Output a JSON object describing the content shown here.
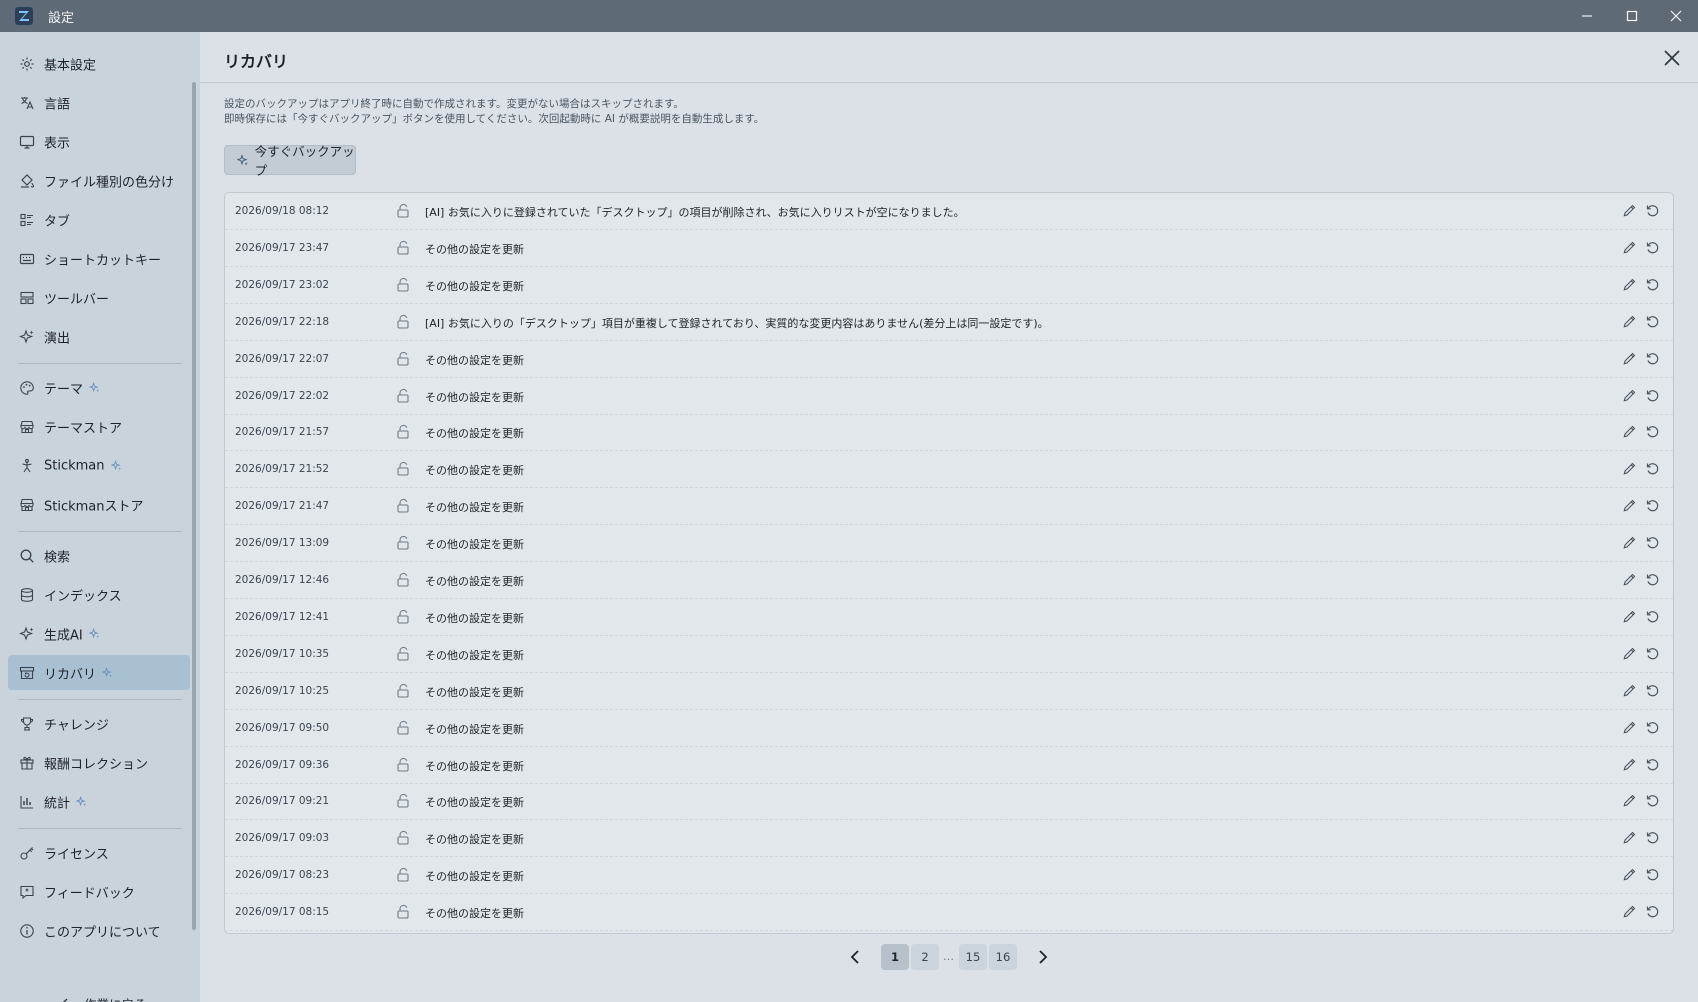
{
  "window": {
    "title": "設定"
  },
  "sidebar": {
    "groups": [
      [
        {
          "label": "基本設定",
          "icon": "gear-icon"
        },
        {
          "label": "言語",
          "icon": "translate-icon"
        },
        {
          "label": "表示",
          "icon": "monitor-icon"
        },
        {
          "label": "ファイル種別の色分け",
          "icon": "paint-bucket-icon"
        },
        {
          "label": "タブ",
          "icon": "tabs-list-icon"
        },
        {
          "label": "ショートカットキー",
          "icon": "keyboard-icon"
        },
        {
          "label": "ツールバー",
          "icon": "toolbar-grid-icon"
        },
        {
          "label": "演出",
          "icon": "sparkle-icon"
        }
      ],
      [
        {
          "label": "テーマ",
          "icon": "palette-icon",
          "ai": true
        },
        {
          "label": "テーマストア",
          "icon": "store-icon"
        },
        {
          "label": "Stickman",
          "icon": "stickman-icon",
          "ai": true
        },
        {
          "label": "Stickmanストア",
          "icon": "store-icon"
        }
      ],
      [
        {
          "label": "検索",
          "icon": "search-icon"
        },
        {
          "label": "インデックス",
          "icon": "database-icon"
        },
        {
          "label": "生成AI",
          "icon": "sparkle-icon",
          "ai": true
        },
        {
          "label": "リカバリ",
          "icon": "recovery-box-icon",
          "ai": true,
          "active": true
        }
      ],
      [
        {
          "label": "チャレンジ",
          "icon": "trophy-icon"
        },
        {
          "label": "報酬コレクション",
          "icon": "gift-icon"
        },
        {
          "label": "統計",
          "icon": "bar-chart-icon",
          "ai": true
        }
      ],
      [
        {
          "label": "ライセンス",
          "icon": "key-icon"
        },
        {
          "label": "フィードバック",
          "icon": "feedback-icon"
        },
        {
          "label": "このアプリについて",
          "icon": "info-icon"
        }
      ]
    ],
    "back_label": "作業に戻る"
  },
  "main": {
    "title": "リカバリ",
    "description": [
      "設定のバックアップはアプリ終了時に自動で作成されます。変更がない場合はスキップされます。",
      "即時保存には「今すぐバックアップ」ボタンを使用してください。次回起動時に AI が概要説明を自動生成します。"
    ],
    "backup_button": "今すぐバックアップ",
    "backups": [
      {
        "date": "2026/09/18 08:12",
        "summary": "[AI] お気に入りに登録されていた「デスクトップ」の項目が削除され、お気に入りリストが空になりました。"
      },
      {
        "date": "2026/09/17 23:47",
        "summary": "その他の設定を更新"
      },
      {
        "date": "2026/09/17 23:02",
        "summary": "その他の設定を更新"
      },
      {
        "date": "2026/09/17 22:18",
        "summary": "[AI] お気に入りの「デスクトップ」項目が重複して登録されており、実質的な変更内容はありません(差分上は同一設定です)。"
      },
      {
        "date": "2026/09/17 22:07",
        "summary": "その他の設定を更新"
      },
      {
        "date": "2026/09/17 22:02",
        "summary": "その他の設定を更新"
      },
      {
        "date": "2026/09/17 21:57",
        "summary": "その他の設定を更新"
      },
      {
        "date": "2026/09/17 21:52",
        "summary": "その他の設定を更新"
      },
      {
        "date": "2026/09/17 21:47",
        "summary": "その他の設定を更新"
      },
      {
        "date": "2026/09/17 13:09",
        "summary": "その他の設定を更新"
      },
      {
        "date": "2026/09/17 12:46",
        "summary": "その他の設定を更新"
      },
      {
        "date": "2026/09/17 12:41",
        "summary": "その他の設定を更新"
      },
      {
        "date": "2026/09/17 10:35",
        "summary": "その他の設定を更新"
      },
      {
        "date": "2026/09/17 10:25",
        "summary": "その他の設定を更新"
      },
      {
        "date": "2026/09/17 09:50",
        "summary": "その他の設定を更新"
      },
      {
        "date": "2026/09/17 09:36",
        "summary": "その他の設定を更新"
      },
      {
        "date": "2026/09/17 09:21",
        "summary": "その他の設定を更新"
      },
      {
        "date": "2026/09/17 09:03",
        "summary": "その他の設定を更新"
      },
      {
        "date": "2026/09/17 08:23",
        "summary": "その他の設定を更新"
      },
      {
        "date": "2026/09/17 08:15",
        "summary": "その他の設定を更新"
      }
    ],
    "pagination": {
      "current": "1",
      "pages": [
        "1",
        "2",
        "…",
        "15",
        "16"
      ]
    }
  },
  "colors": {
    "titlebar": "#5e6a75",
    "sidebar": "#c9d3dc",
    "sidebar_active": "#a9c0d3",
    "content_bg": "#dbe1e6",
    "ai_sparkle": "#6b8fb8"
  }
}
